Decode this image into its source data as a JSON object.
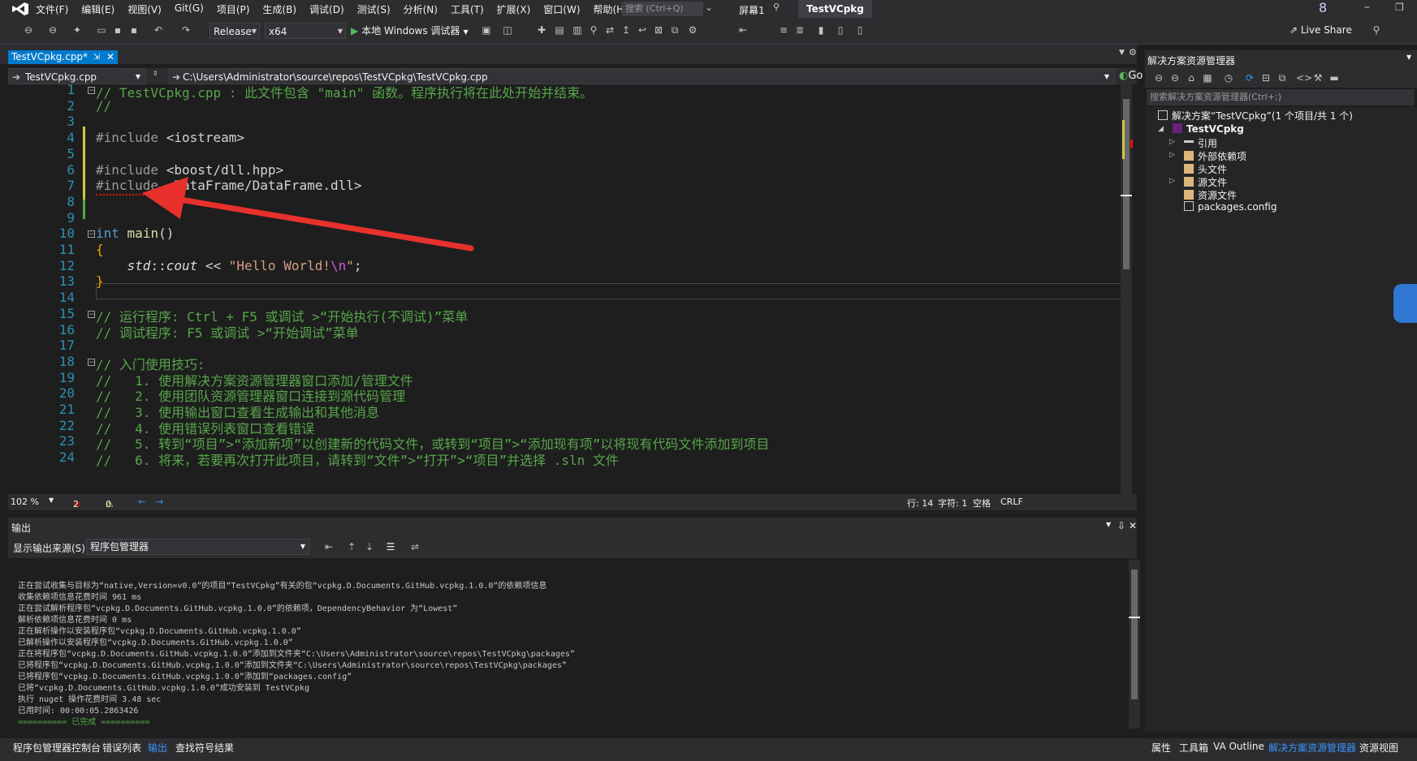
{
  "menu": {
    "items": [
      "文件(F)",
      "编辑(E)",
      "视图(V)",
      "Git(G)",
      "项目(P)",
      "生成(B)",
      "调试(D)",
      "测试(S)",
      "分析(N)",
      "工具(T)",
      "扩展(X)",
      "窗口(W)",
      "帮助(H)"
    ],
    "search_placeholder": "搜索 (Ctrl+Q)",
    "screen_label": "屏幕1",
    "project_name": "TestVCpkg",
    "window_number": "8"
  },
  "toolbar": {
    "configuration": "Release",
    "platform": "x64",
    "run_label": "本地 Windows 调试器",
    "live_share": "Live Share"
  },
  "document": {
    "tab_label": "TestVCpkg.cpp*",
    "nav_file": "TestVCpkg.cpp",
    "nav_path": "C:\\Users\\Administrator\\source\\repos\\TestVCpkg\\TestVCpkg.cpp",
    "nav_go": "Go"
  },
  "code_lines": [
    {
      "n": "1",
      "text": "// TestVCpkg.cpp : 此文件包含 \"main\" 函数。程序执行将在此处开始并结束。"
    },
    {
      "n": "2",
      "text": "//"
    },
    {
      "n": "3",
      "text": ""
    },
    {
      "n": "4",
      "text": "#include <iostream>"
    },
    {
      "n": "5",
      "text": ""
    },
    {
      "n": "6",
      "text": "#include <boost/dll.hpp>"
    },
    {
      "n": "7",
      "text": "#include <DataFrame/DataFrame.dll>"
    },
    {
      "n": "8",
      "text": ""
    },
    {
      "n": "9",
      "text": ""
    },
    {
      "n": "10",
      "text": "int main()"
    },
    {
      "n": "11",
      "text": "{"
    },
    {
      "n": "12",
      "text": "    std::cout << \"Hello World!\\n\";"
    },
    {
      "n": "13",
      "text": "}"
    },
    {
      "n": "14",
      "text": ""
    },
    {
      "n": "15",
      "text": "// 运行程序: Ctrl + F5 或调试 >“开始执行(不调试)”菜单"
    },
    {
      "n": "16",
      "text": "// 调试程序: F5 或调试 >“开始调试”菜单"
    },
    {
      "n": "17",
      "text": ""
    },
    {
      "n": "18",
      "text": "// 入门使用技巧:"
    },
    {
      "n": "19",
      "text": "//   1. 使用解决方案资源管理器窗口添加/管理文件"
    },
    {
      "n": "20",
      "text": "//   2. 使用团队资源管理器窗口连接到源代码管理"
    },
    {
      "n": "21",
      "text": "//   3. 使用输出窗口查看生成输出和其他消息"
    },
    {
      "n": "22",
      "text": "//   4. 使用错误列表窗口查看错误"
    },
    {
      "n": "23",
      "text": "//   5. 转到“项目”>“添加新项”以创建新的代码文件，或转到“项目”>“添加现有项”以将现有代码文件添加到项目"
    },
    {
      "n": "24",
      "text": "//   6. 将来，若要再次打开此项目，请转到“文件”>“打开”>“项目”并选择 .sln 文件"
    }
  ],
  "editor_status": {
    "zoom": "102 %",
    "errors": "2",
    "warnings": "0",
    "line": "行: 14",
    "char": "字符: 1",
    "whitespace": "空格",
    "eol": "CRLF"
  },
  "output": {
    "title": "输出",
    "source_label": "显示输出来源(S):",
    "source_value": "程序包管理器",
    "lines": [
      "正在尝试收集与目标为“native,Version=v0.0”的项目“TestVCpkg”有关的包“vcpkg.D.Documents.GitHub.vcpkg.1.0.0”的依赖项信息",
      "收集依赖项信息花费时间 961 ms",
      "正在尝试解析程序包“vcpkg.D.Documents.GitHub.vcpkg.1.0.0”的依赖项，DependencyBehavior 为“Lowest”",
      "解析依赖项信息花费时间 0 ms",
      "正在解析操作以安装程序包“vcpkg.D.Documents.GitHub.vcpkg.1.0.0”",
      "已解析操作以安装程序包“vcpkg.D.Documents.GitHub.vcpkg.1.0.0”",
      "正在将程序包“vcpkg.D.Documents.GitHub.vcpkg.1.0.0”添加到文件夹“C:\\Users\\Administrator\\source\\repos\\TestVCpkg\\packages”",
      "已将程序包“vcpkg.D.Documents.GitHub.vcpkg.1.0.0”添加到文件夹“C:\\Users\\Administrator\\source\\repos\\TestVCpkg\\packages”",
      "已将程序包“vcpkg.D.Documents.GitHub.vcpkg.1.0.0”添加到“packages.config”",
      "已将“vcpkg.D.Documents.GitHub.vcpkg.1.0.0”成功安装到 TestVCpkg",
      "执行 nuget 操作花费时间 3.48 sec",
      "已用时间: 00:00:05.2863426",
      "========== 已完成 =========="
    ]
  },
  "bottom_tabs": {
    "left": [
      "程序包管理器控制台",
      "错误列表",
      "输出",
      "查找符号结果"
    ],
    "right": [
      "属性",
      "工具箱",
      "VA Outline",
      "解决方案资源管理器",
      "资源视图"
    ]
  },
  "solution_explorer": {
    "title": "解决方案资源管理器",
    "search_placeholder": "搜索解决方案资源管理器(Ctrl+;)",
    "solution_label": "解决方案“TestVCpkg”(1 个项目/共 1 个)",
    "project_label": "TestVCpkg",
    "items": [
      "引用",
      "外部依赖项",
      "头文件",
      "源文件",
      "资源文件",
      "packages.config"
    ]
  },
  "colors": {
    "accent": "#007acc",
    "arrow": "#e8312c",
    "comment": "#57a64a"
  }
}
